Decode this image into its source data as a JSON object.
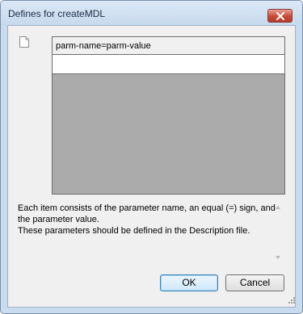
{
  "window": {
    "title": "Defines for createMDL"
  },
  "icons": {
    "close": "close-icon",
    "document": "document-icon",
    "scroll_up": "scroll-up-icon",
    "scroll_down": "scroll-down-icon",
    "size_grip": "size-grip-icon"
  },
  "grid": {
    "header": "parm-name=parm-value",
    "rows": [
      ""
    ]
  },
  "description": {
    "line1": "Each item consists of the parameter name, an equal (=) sign, and",
    "line2": "the parameter value.",
    "line3": "These parameters should be defined in the Description file."
  },
  "buttons": {
    "ok": "OK",
    "cancel": "Cancel"
  },
  "colors": {
    "titlebar": "#c7d9ed",
    "client": "#f0f0f0",
    "grid_empty": "#ababab",
    "close": "#c74a38"
  }
}
